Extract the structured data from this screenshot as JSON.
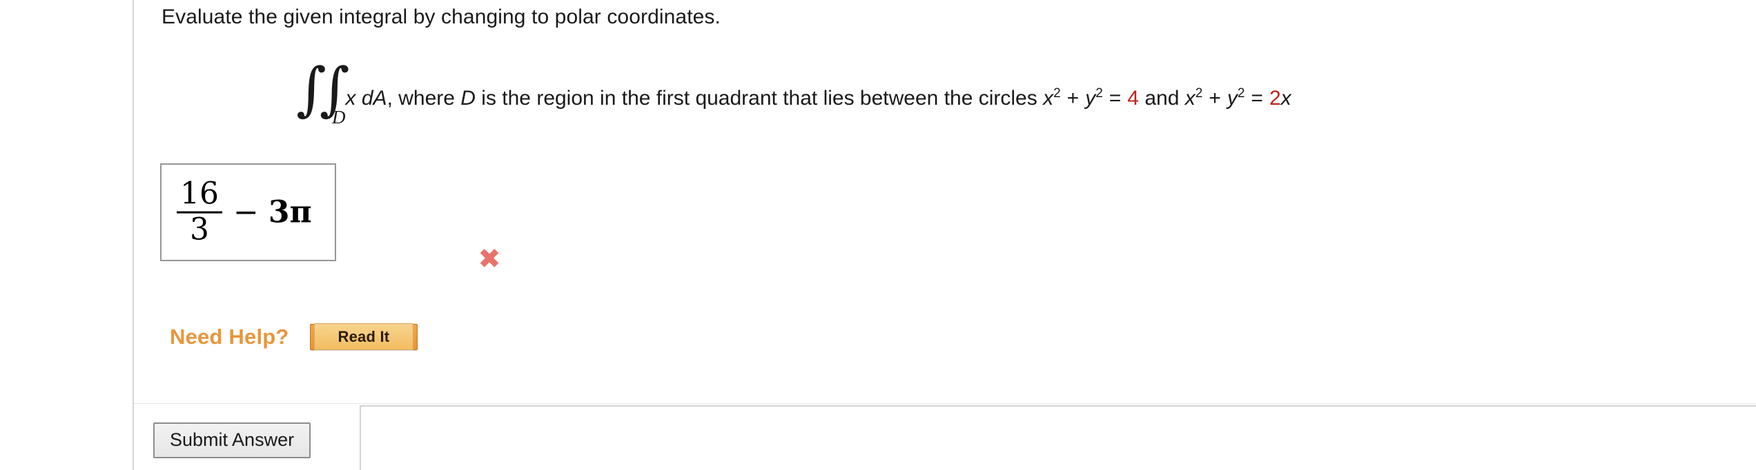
{
  "question": {
    "prompt": "Evaluate the given integral by changing to polar coordinates.",
    "integral": {
      "symbol": "∫∫",
      "subscript": "D",
      "integrand": "x dA",
      "text_after_integrand": ", where ",
      "region_var": "D",
      "text_region": " is the region in the first quadrant that lies between the circles ",
      "circle1": {
        "base_x": "x",
        "base_y": "y",
        "exponent": "2",
        "plus": "+",
        "equals": "=",
        "value": "4"
      },
      "conjunction": " and ",
      "circle2": {
        "base_x": "x",
        "base_y": "y",
        "exponent": "2",
        "plus": "+",
        "equals": "=",
        "coefficient": "2",
        "variable": "x"
      }
    }
  },
  "answer": {
    "numerator": "16",
    "denominator": "3",
    "operator": "−",
    "term": "3π",
    "status_icon": "✖",
    "status": "incorrect"
  },
  "help": {
    "label": "Need Help?",
    "read_it_button": "Read It"
  },
  "footer": {
    "submit_label": "Submit Answer"
  },
  "colors": {
    "red_value": "#c0221b",
    "orange_help": "#e8963c",
    "wrong_mark": "#e8736a",
    "text": "#1a1a1a",
    "border_grey": "#969696"
  }
}
